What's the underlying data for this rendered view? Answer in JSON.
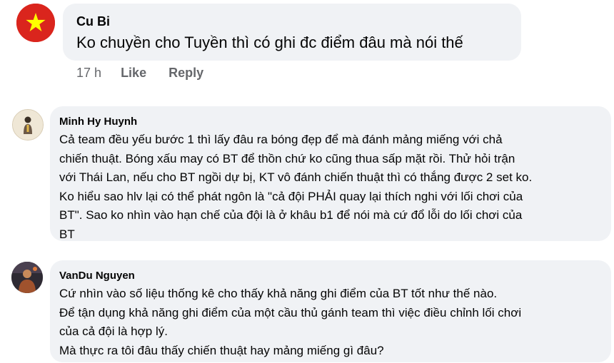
{
  "comments": [
    {
      "author": "Cu Bi",
      "lines": [
        "Ko chuyền cho Tuyền thì có ghi đc điểm đâu mà nói thế"
      ],
      "time": "17 h",
      "like_label": "Like",
      "reply_label": "Reply",
      "avatar_icon": "vietnam-flag-icon",
      "avatar_color": "#da251d"
    },
    {
      "author": "Minh Hy Huynh",
      "lines": [
        "Cả team đều yếu bước 1 thì lấy đâu ra bóng đẹp để mà đánh mảng miếng với chả",
        "chiến thuật. Bóng xấu may có BT để thồn chứ ko cũng thua sấp mặt rồi. Thử hỏi trận",
        "với Thái Lan, nếu cho BT ngồi dự bị, KT vô đánh chiến thuật thì có thắng được 2 set ko.",
        "Ko hiểu sao hlv lại có thể phát ngôn là \"cả đội PHẢI quay lại thích nghi với lối chơi của",
        "BT\". Sao ko nhìn vào hạn chế của đội là ở khâu b1 để nói mà cứ đổ lỗi do lối chơi của",
        "BT"
      ],
      "avatar_icon": "profile-photo-icon"
    },
    {
      "author": "VanDu Nguyen",
      "lines": [
        "Cứ nhìn vào số liệu thống kê cho thấy khả năng ghi điểm của BT tốt như thế nào.",
        "Để tận dụng khả năng ghi điểm của một cầu thủ gánh team thì việc điều chỉnh lối chơi",
        "của cả đội là hợp lý.",
        "Mà thực ra tôi đâu thấy chiến thuật hay mảng miếng gì đâu?"
      ],
      "avatar_icon": "profile-photo-icon"
    }
  ],
  "colors": {
    "bubble_bg": "#f0f2f5",
    "text": "#050505",
    "meta_text": "#65676b",
    "flag_red": "#da251d",
    "flag_star": "#ffff00"
  }
}
